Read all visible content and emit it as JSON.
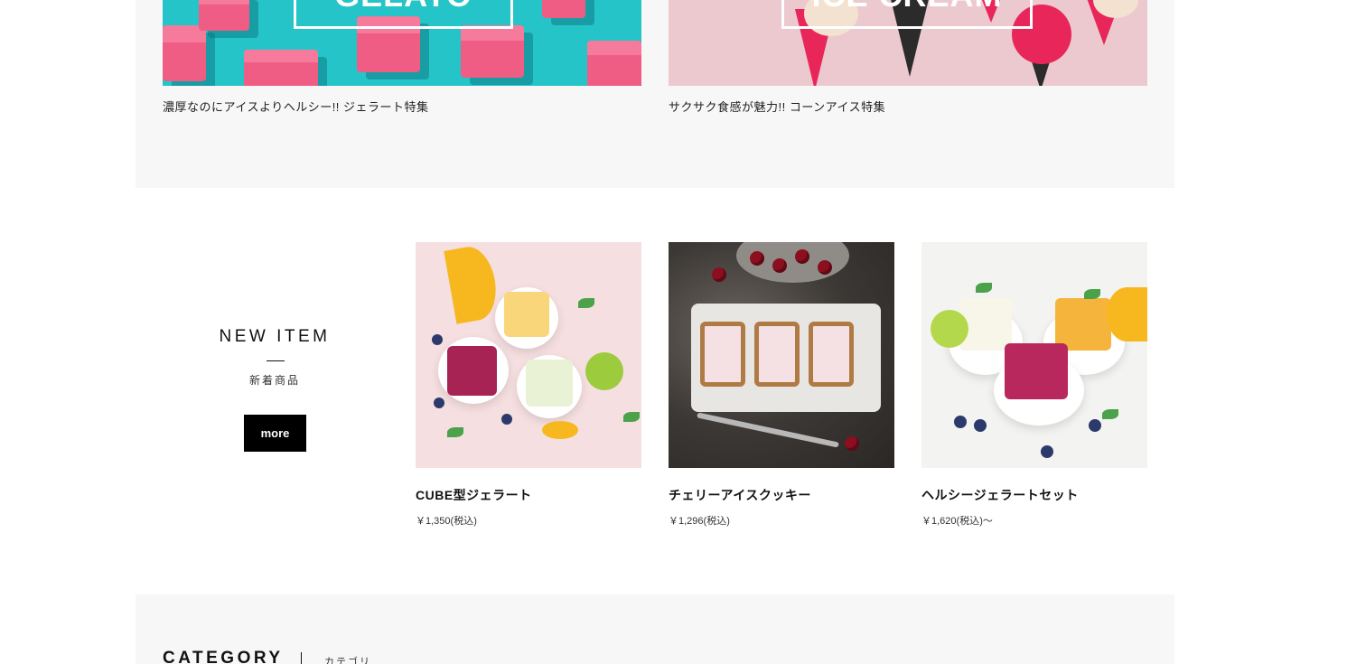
{
  "features": {
    "gelato": {
      "banner_text": "GELATO",
      "caption": "濃厚なのにアイスよりヘルシー!! ジェラート特集"
    },
    "icecream": {
      "banner_text": "ICE CREAM",
      "caption": "サクサク食感が魅力!! コーンアイス特集"
    }
  },
  "new_item": {
    "heading": "NEW ITEM",
    "subheading": "新着商品",
    "more_label": "more",
    "products": [
      {
        "name": "CUBE型ジェラート",
        "price": "￥1,350(税込)"
      },
      {
        "name": "チェリーアイスクッキー",
        "price": "￥1,296(税込)"
      },
      {
        "name": "ヘルシージェラートセット",
        "price": "￥1,620(税込)～"
      }
    ]
  },
  "category": {
    "heading": "CATEGORY",
    "subheading": "カテゴリ"
  },
  "colors": {
    "section_bg": "#f7f7f7",
    "gelato_bg": "#25c4c9",
    "icecream_bg": "#ecc9cf",
    "button_bg": "#000000"
  }
}
